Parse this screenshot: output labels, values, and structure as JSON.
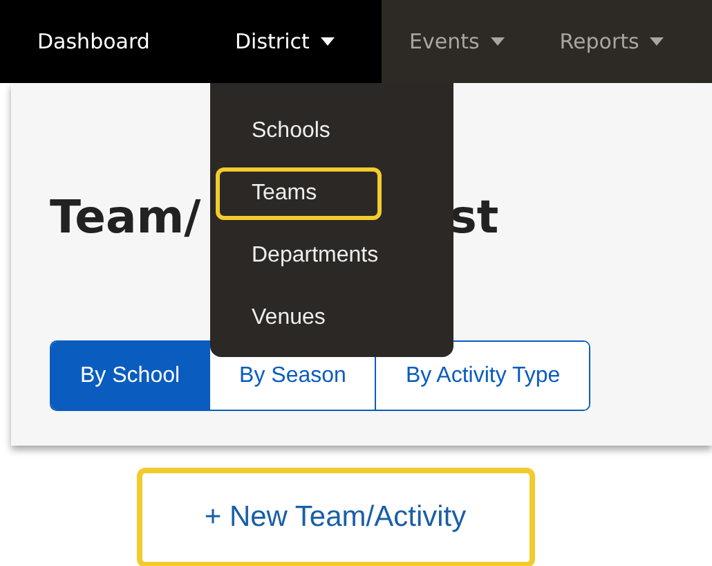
{
  "nav": [
    {
      "label": "Dashboard",
      "muted": false,
      "has_menu": false
    },
    {
      "label": "District",
      "muted": false,
      "has_menu": true
    },
    {
      "label": "Events",
      "muted": true,
      "has_menu": true
    },
    {
      "label": "Reports",
      "muted": true,
      "has_menu": true
    }
  ],
  "dropdown": [
    {
      "label": "Schools",
      "highlighted": false
    },
    {
      "label": "Teams",
      "highlighted": true
    },
    {
      "label": "Departments",
      "highlighted": false
    },
    {
      "label": "Venues",
      "highlighted": false
    }
  ],
  "heading": {
    "visible_start": "Team/",
    "visible_end": "st"
  },
  "tabs": [
    {
      "label": "By School",
      "selected": true
    },
    {
      "label": "By Season",
      "selected": false
    },
    {
      "label": "By Activity Type",
      "selected": false
    }
  ],
  "new_button": {
    "label": "+ New Team/Activity",
    "highlighted": true
  }
}
